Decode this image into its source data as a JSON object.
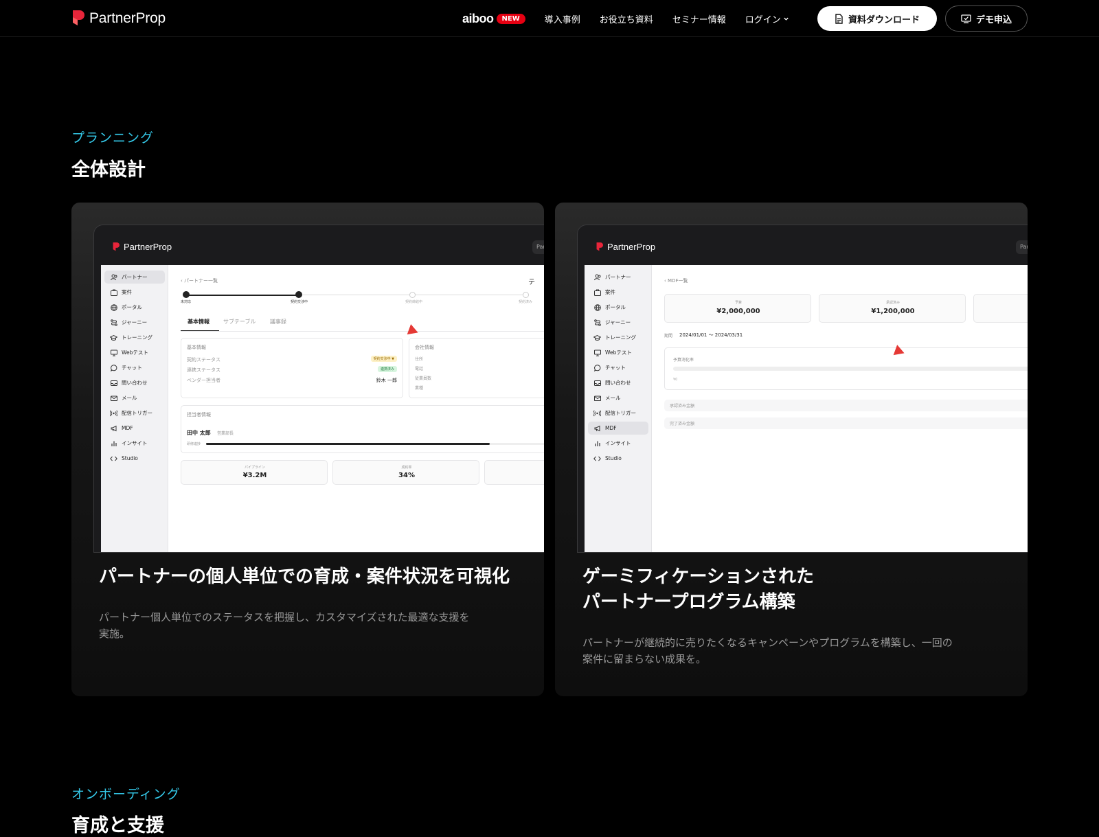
{
  "header": {
    "logo_text": "PartnerProp",
    "aiboo_label": "aiboo",
    "new_badge": "NEW",
    "links": [
      "導入事例",
      "お役立ち資料",
      "セミナー情報"
    ],
    "login_label": "ログイン",
    "download_button": "資料ダウンロード",
    "demo_button": "デモ申込"
  },
  "section1": {
    "eyebrow": "プランニング",
    "title": "全体設計"
  },
  "section2": {
    "eyebrow": "オンボーディング",
    "title": "育成と支援"
  },
  "sidebar_items": [
    "パートナー",
    "案件",
    "ポータル",
    "ジャーニー",
    "トレーニング",
    "Webテスト",
    "チャット",
    "問い合わせ",
    "メール",
    "配信トリガー",
    "MDF",
    "インサイト",
    "Studio"
  ],
  "card1": {
    "shot_logo": "PartnerProp",
    "shot_pill": "Par",
    "breadcrumb": "‹ パートナー一覧",
    "header_cut": "テ",
    "steps": [
      "未対応",
      "契約交渉中",
      "契約締結中",
      "契約済み"
    ],
    "tabs": [
      "基本情報",
      "サブテーブル",
      "議事録"
    ],
    "basic_info": {
      "title": "基本情報",
      "rows": [
        {
          "label": "契約ステータス",
          "value": "契約交渉中 ▼"
        },
        {
          "label": "連携ステータス",
          "value": "連携済み"
        },
        {
          "label": "ベンダー担当者",
          "value": "鈴木 一郎"
        }
      ]
    },
    "company_info": {
      "title": "会社情報",
      "fields": [
        "住所",
        "電話",
        "従業員数",
        "業種"
      ]
    },
    "contact": {
      "title": "担当者情報",
      "name": "田中 太郎",
      "role": "営業部長",
      "progress_label": "研修進捗",
      "progress": 0.78
    },
    "stats": [
      {
        "label": "パイプライン",
        "value": "¥3.2M"
      },
      {
        "label": "成約率",
        "value": "34%"
      }
    ],
    "title": "パートナーの個人単位での育成・案件状況を可視化",
    "desc_lines": [
      "パートナー個人単位でのステータスを把握し、カスタマイズされた最適な支援を",
      "実施。"
    ]
  },
  "card2": {
    "shot_logo": "PartnerProp",
    "shot_pill": "Par",
    "breadcrumb": "‹ MDF一覧",
    "stats": [
      {
        "label": "予算",
        "value": "¥2,000,000"
      },
      {
        "label": "承認済み",
        "value": "¥1,200,000"
      }
    ],
    "period_label": "期間",
    "period_value": "2024/01/01 〜 2024/03/31",
    "usage_label": "予算消化率",
    "usage_value": "¥0",
    "rows": [
      "承認済み金額",
      "完了済み金額"
    ],
    "title_lines": [
      "ゲーミフィケーションされた",
      "パートナープログラム構築"
    ],
    "desc_lines": [
      "パートナーが継続的に売りたくなるキャンペーンやプログラムを構築し、一回の",
      "案件に留まらない成果を。"
    ]
  },
  "colors": {
    "accent": "#34c8e8",
    "brand_red": "#e8253a",
    "new_badge": "#e60012",
    "cursor": "#e53935"
  }
}
